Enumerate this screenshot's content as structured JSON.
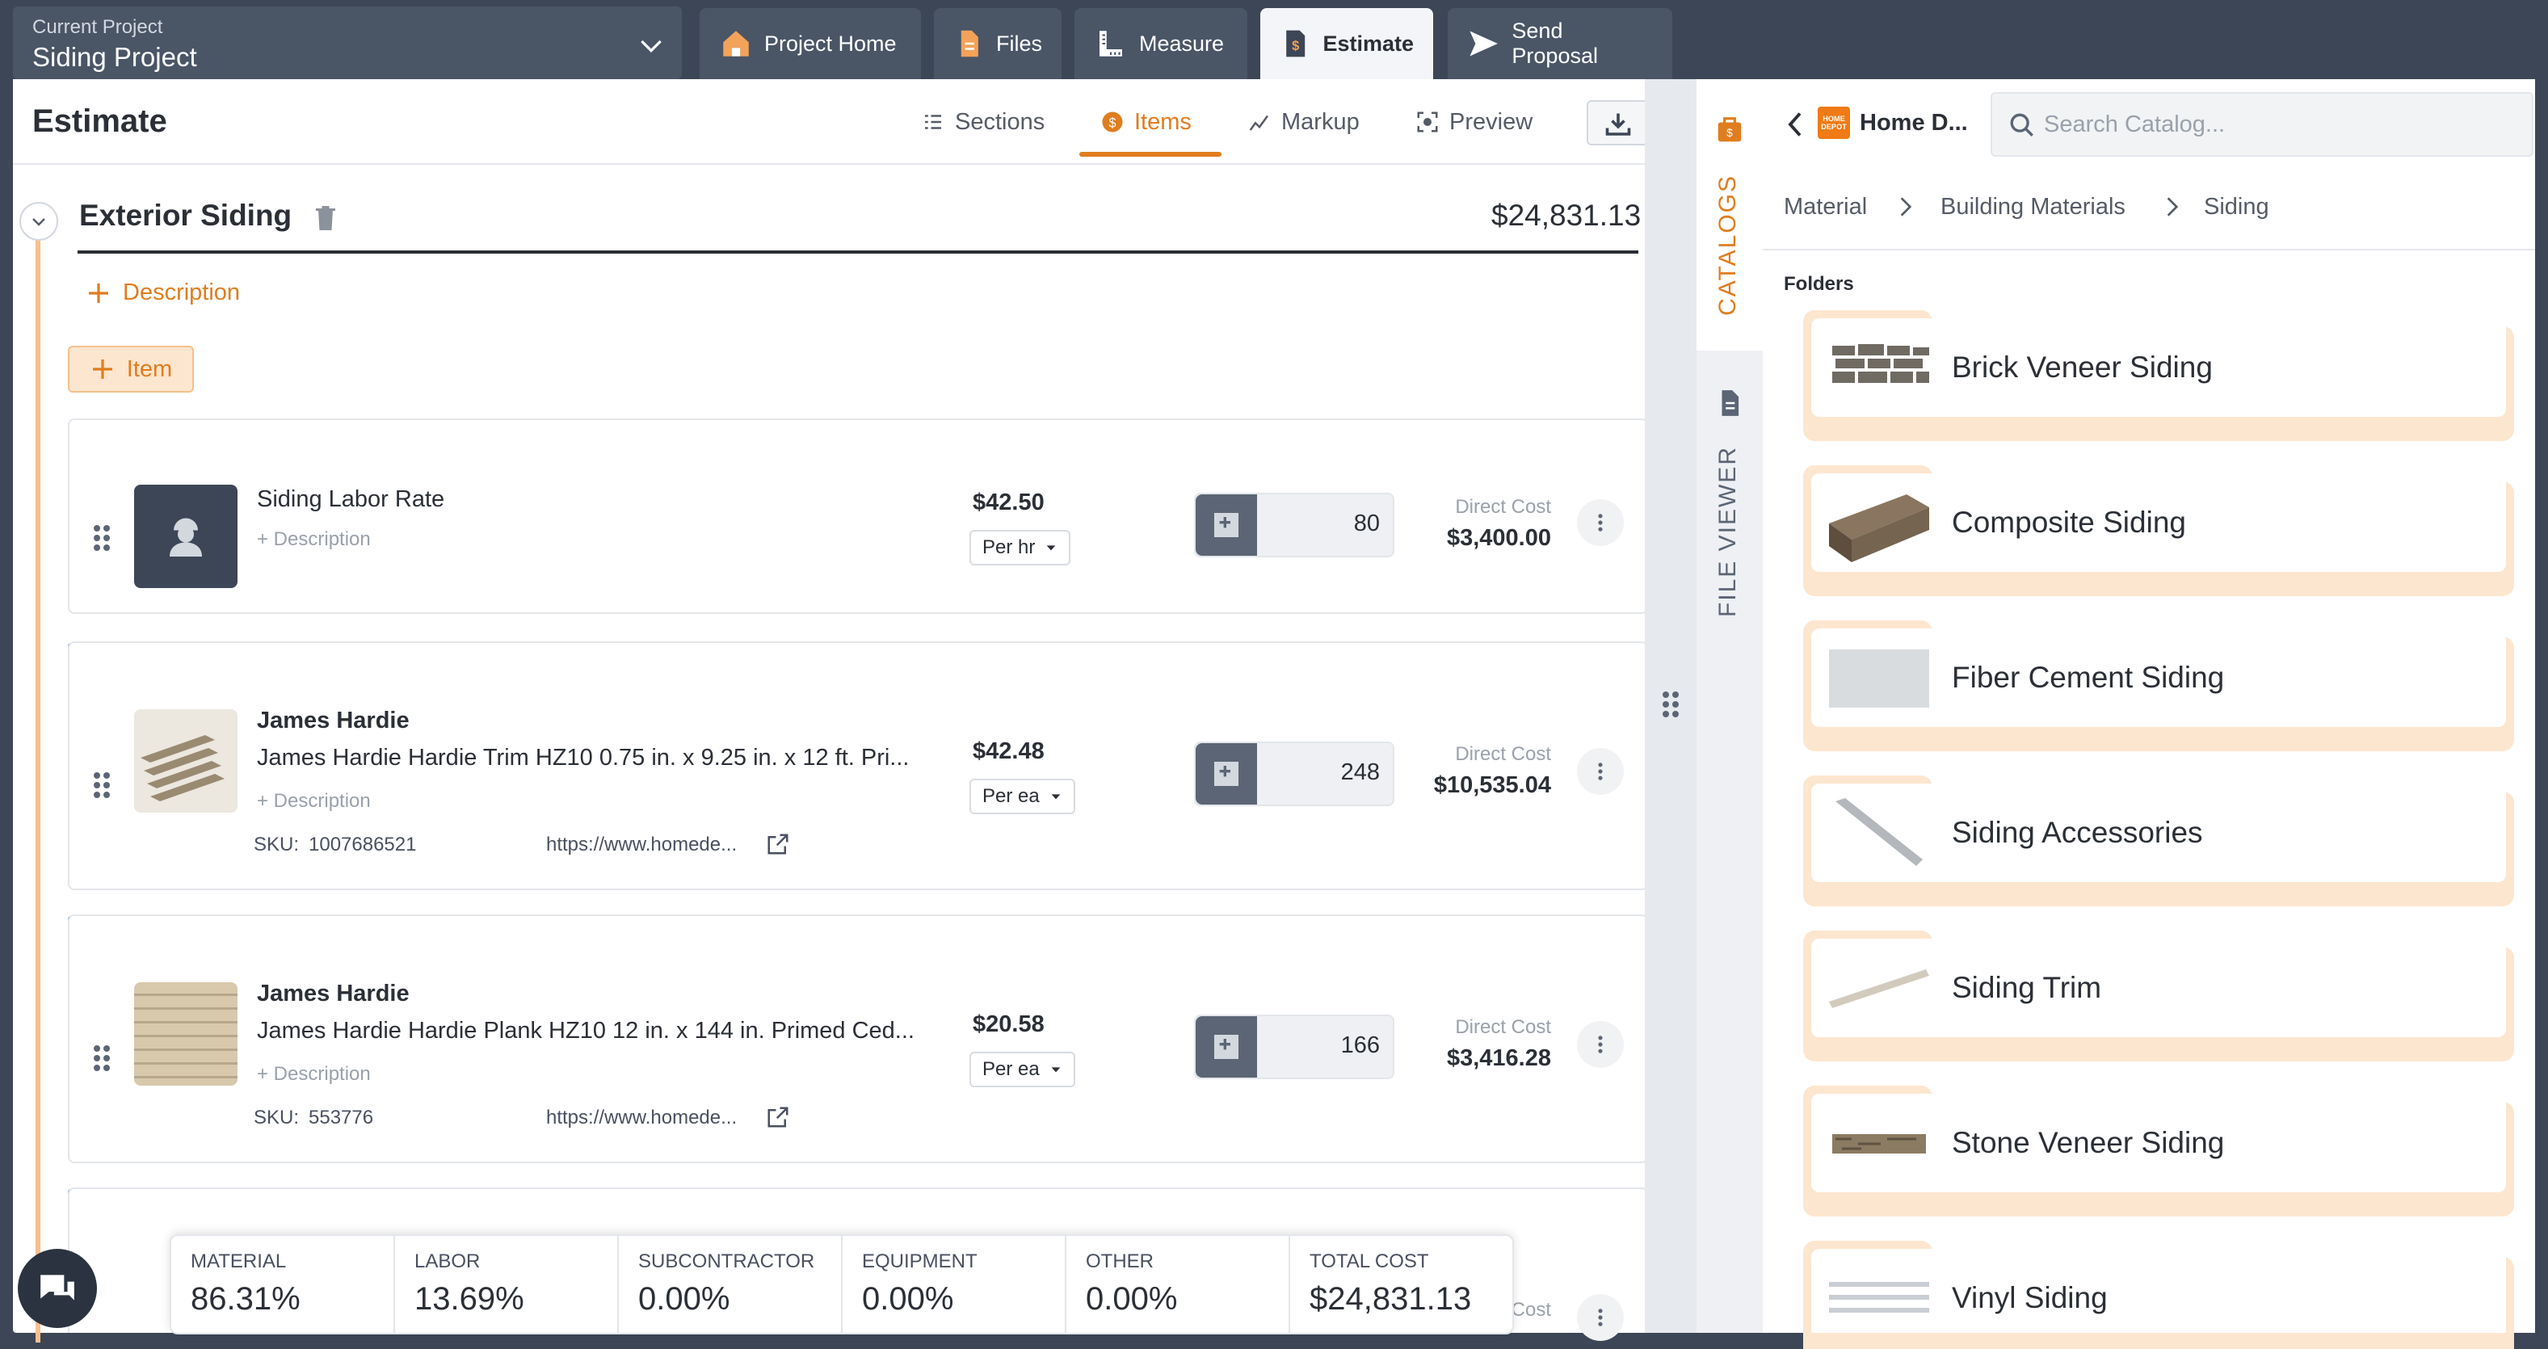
{
  "project": {
    "label": "Current Project",
    "name": "Siding Project"
  },
  "nav_tabs": [
    {
      "label": "Project Home",
      "icon": "house-icon"
    },
    {
      "label": "Files",
      "icon": "file-icon"
    },
    {
      "label": "Measure",
      "icon": "ruler-icon"
    },
    {
      "label": "Estimate",
      "icon": "estimate-icon",
      "active": true
    },
    {
      "label": "Send Proposal",
      "icon": "send-icon"
    }
  ],
  "estimate": {
    "title": "Estimate",
    "tabs": [
      {
        "label": "Sections",
        "icon": "list-icon"
      },
      {
        "label": "Items",
        "icon": "dollar-icon",
        "active": true
      },
      {
        "label": "Markup",
        "icon": "chart-icon"
      },
      {
        "label": "Preview",
        "icon": "preview-icon"
      }
    ]
  },
  "section": {
    "title": "Exterior Siding",
    "total": "$24,831.13",
    "add_description": "Description",
    "add_item": "Item"
  },
  "items": [
    {
      "type": "Labor",
      "brand": "",
      "name": "Siding Labor Rate",
      "add_desc": "+ Description",
      "price": "$42.50",
      "unit": "Per hr",
      "qty": "80",
      "dc_label": "Direct Cost",
      "dc_value": "$3,400.00"
    },
    {
      "type": "Material",
      "brand": "James Hardie",
      "name": "James Hardie Hardie Trim HZ10 0.75 in. x 9.25 in. x 12 ft. Pri...",
      "add_desc": "+ Description",
      "sku_label": "SKU:",
      "sku": "1007686521",
      "url": "https://www.homede...",
      "price": "$42.48",
      "unit": "Per ea",
      "qty": "248",
      "dc_label": "Direct Cost",
      "dc_value": "$10,535.04"
    },
    {
      "type": "Material",
      "brand": "James Hardie",
      "name": "James Hardie Hardie Plank HZ10 12 in. x 144 in. Primed Ced...",
      "add_desc": "+ Description",
      "sku_label": "SKU:",
      "sku": "553776",
      "url": "https://www.homede...",
      "price": "$20.58",
      "unit": "Per ea",
      "qty": "166",
      "dc_label": "Direct Cost",
      "dc_value": "$3,416.28"
    },
    {
      "type": "Material",
      "dc_label": "Cost"
    }
  ],
  "summary": [
    {
      "label": "MATERIAL",
      "value": "86.31%"
    },
    {
      "label": "LABOR",
      "value": "13.69%"
    },
    {
      "label": "SUBCONTRACTOR",
      "value": "0.00%"
    },
    {
      "label": "EQUIPMENT",
      "value": "0.00%"
    },
    {
      "label": "OTHER",
      "value": "0.00%"
    },
    {
      "label": "TOTAL COST",
      "value": "$24,831.13"
    }
  ],
  "rail": {
    "catalogs": "CATALOGS",
    "file_viewer": "FILE VIEWER"
  },
  "catalog": {
    "store": "Home D...",
    "logo_text": "HOME DEPOT",
    "search_placeholder": "Search Catalog...",
    "breadcrumbs": [
      "Material",
      "Building Materials",
      "Siding"
    ],
    "folders_label": "Folders",
    "folders": [
      "Brick Veneer Siding",
      "Composite Siding",
      "Fiber Cement Siding",
      "Siding Accessories",
      "Siding Trim",
      "Stone Veneer Siding",
      "Vinyl Siding"
    ]
  },
  "colors": {
    "accent": "#e07d1e",
    "material_tag": "#3e86d6",
    "labor_tag": "#e07d1e",
    "topbar": "#3c4656"
  }
}
